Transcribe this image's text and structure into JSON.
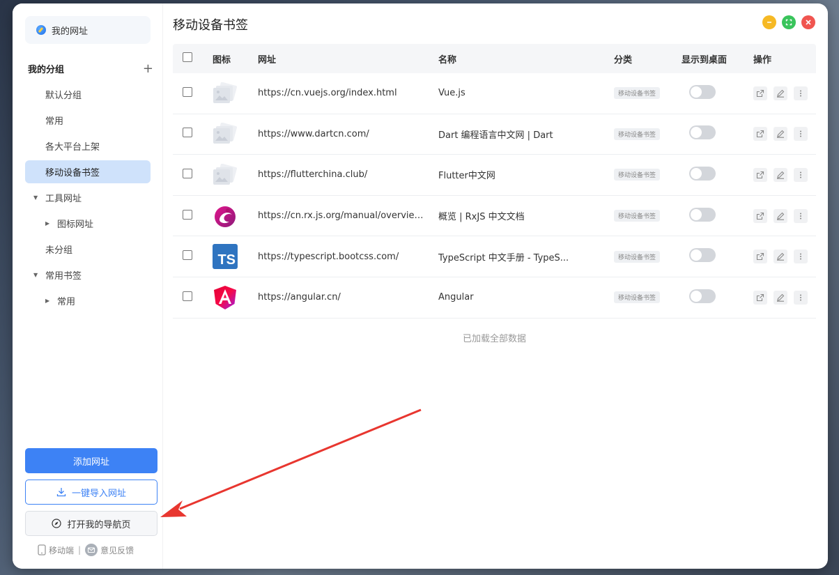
{
  "sidebar": {
    "site_card_label": "我的网址",
    "group_title": "我的分组",
    "add_group_symbol": "+",
    "items": [
      {
        "label": "默认分组"
      },
      {
        "label": "常用"
      },
      {
        "label": "各大平台上架"
      },
      {
        "label": "移动设备书签"
      },
      {
        "label": "工具网址"
      },
      {
        "label": "图标网址"
      },
      {
        "label": "未分组"
      },
      {
        "label": "常用书签"
      },
      {
        "label": "常用"
      }
    ],
    "add_url_button": "添加网址",
    "import_button": "一键导入网址",
    "open_nav_button": "打开我的导航页",
    "footer_mobile": "移动端",
    "footer_sep": "|",
    "footer_feedback": "意见反馈"
  },
  "main": {
    "page_title": "移动设备书签",
    "columns": [
      "图标",
      "网址",
      "名称",
      "分类",
      "显示到桌面",
      "操作"
    ],
    "rows": [
      {
        "url": "https://cn.vuejs.org/index.html",
        "name": "Vue.js",
        "category": "移动设备书签",
        "icon": "image-placeholder-icon"
      },
      {
        "url": "https://www.dartcn.com/",
        "name": "Dart 编程语言中文网 | Dart",
        "category": "移动设备书签",
        "icon": "image-placeholder-icon"
      },
      {
        "url": "https://flutterchina.club/",
        "name": "Flutter中文网",
        "category": "移动设备书签",
        "icon": "image-placeholder-icon"
      },
      {
        "url": "https://cn.rx.js.org/manual/overview...",
        "name": "概览 | RxJS 中文文档",
        "category": "移动设备书签",
        "icon": "rxjs-logo-icon"
      },
      {
        "url": "https://typescript.bootcss.com/",
        "name": "TypeScript 中文手册 - TypeS...",
        "category": "移动设备书签",
        "icon": "typescript-logo-icon"
      },
      {
        "url": "https://angular.cn/",
        "name": "Angular",
        "category": "移动设备书签",
        "icon": "angular-logo-icon"
      }
    ],
    "ts_logo_text": "TS",
    "loaded_text": "已加载全部数据"
  },
  "colors": {
    "primary": "#3d82f5",
    "active_nav": "#cfe2fb",
    "min": "#f6b924",
    "max": "#39c45b",
    "close": "#f05550",
    "annotation_arrow": "#e8362f"
  }
}
